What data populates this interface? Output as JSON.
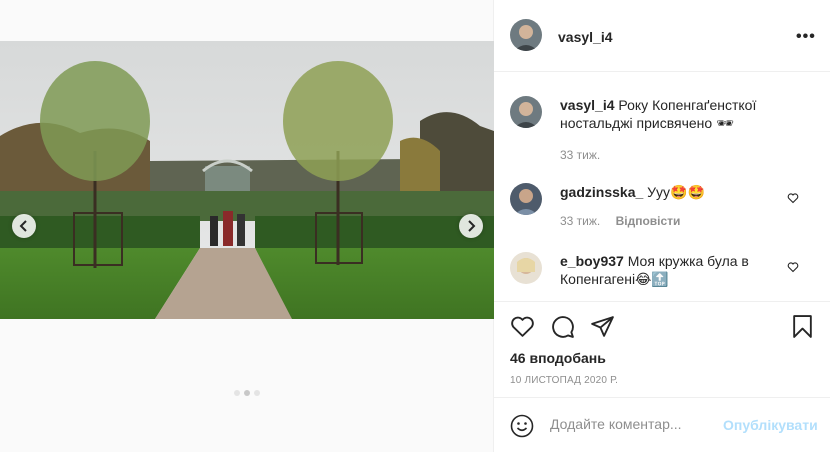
{
  "post": {
    "username": "vasyl_i4",
    "more_label": "•••",
    "caption": {
      "username": "vasyl_i4",
      "text": "Року Копенгаґенсткої ностальджі присвячено 🕶",
      "time": "33 тиж."
    },
    "comments": [
      {
        "username": "gadzinsska_",
        "text": "Ууу🤩🤩",
        "time": "33 тиж.",
        "reply_label": "Відповісти"
      },
      {
        "username": "e_boy937",
        "text": "Моя кружка була в Копенгагені😂🔝",
        "time": "",
        "reply_label": ""
      }
    ],
    "likes": "46 вподобань",
    "date": "10 ЛИСТОПАД 2020 Р.",
    "add_comment": {
      "placeholder": "Додайте коментар...",
      "publish_label": "Опублікувати"
    }
  },
  "icons": {
    "prev": "chevron-left-icon",
    "next": "chevron-right-icon",
    "like": "heart-icon",
    "comment": "comment-icon",
    "share": "paper-plane-icon",
    "save": "bookmark-icon",
    "emoji": "smiley-icon",
    "more": "more-horizontal-icon"
  },
  "carousel": {
    "slides": 3,
    "active": 2
  },
  "colors": {
    "accent_disabled": "#b2dffc",
    "muted": "#8e8e8e",
    "text": "#262626"
  }
}
